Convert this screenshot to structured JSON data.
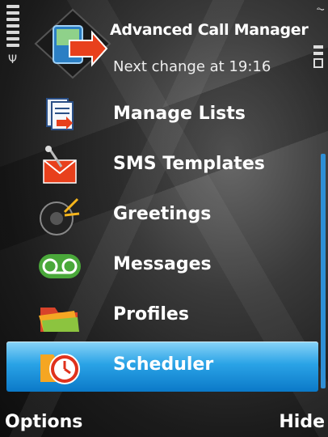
{
  "header": {
    "title": "Advanced Call Manager",
    "status": "Next change at 19:16"
  },
  "menu": {
    "items": [
      {
        "label": "Manage Lists",
        "icon": "manage-lists-icon"
      },
      {
        "label": "SMS Templates",
        "icon": "sms-templates-icon"
      },
      {
        "label": "Greetings",
        "icon": "greetings-icon"
      },
      {
        "label": "Messages",
        "icon": "voicemail-icon"
      },
      {
        "label": "Profiles",
        "icon": "profiles-icon"
      },
      {
        "label": "Scheduler",
        "icon": "scheduler-icon",
        "selected": true
      }
    ]
  },
  "softkeys": {
    "left": "Options",
    "right": "Hide"
  },
  "colors": {
    "selection": "#2aa3e6",
    "scrollbar": "#2e8fd6"
  }
}
